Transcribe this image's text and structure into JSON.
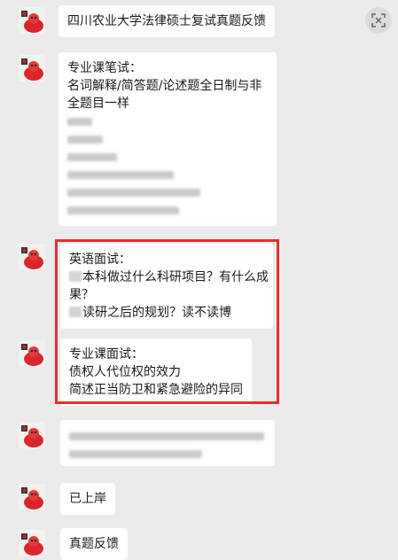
{
  "messages": [
    {
      "text_lines": [
        "四川农业大学法律硕士复试真题反馈"
      ]
    },
    {
      "text_lines": [
        "专业课笔试：",
        "名词解释/简答题/论述题全日制与非",
        "全题目一样"
      ]
    },
    {
      "text_lines": [
        "英语面试：",
        "本科做过什么科研项目？有什么成",
        "果？",
        "读研之后的规划？读不读博"
      ]
    },
    {
      "text_lines": [
        "专业课面试：",
        "债权人代位权的效力",
        "简述正当防卫和紧急避险的异同"
      ]
    },
    {
      "text_lines": []
    },
    {
      "text_lines": [
        "已上岸"
      ]
    },
    {
      "text_lines": [
        "真题反馈"
      ]
    }
  ],
  "colors": {
    "highlight_border": "#ec2d2d",
    "bubble": "#ffffff",
    "background": "#ebebeb"
  },
  "icons": {
    "avatar": "avatar-icon",
    "corner": "scan-icon"
  }
}
